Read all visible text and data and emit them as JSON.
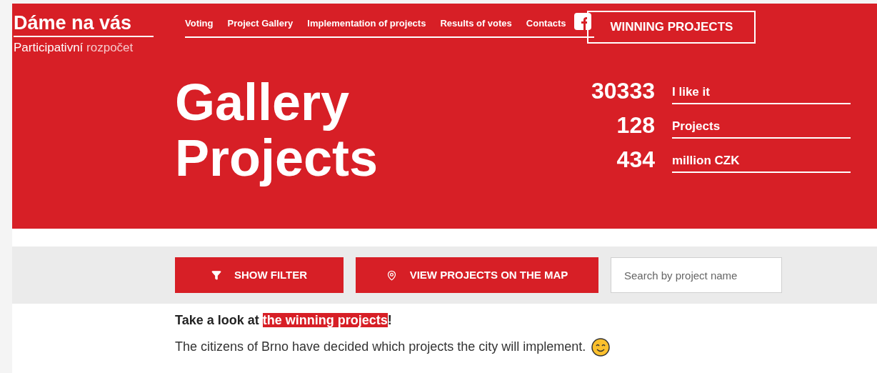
{
  "brand": {
    "name": "Dáme na vás",
    "tagline_strong": "Participativní",
    "tagline_light": "rozpočet"
  },
  "nav": {
    "items": [
      "Voting",
      "Project Gallery",
      "Implementation of projects",
      "Results of votes",
      "Contacts"
    ],
    "cta": "WINNING PROJECTS"
  },
  "hero": {
    "title_lines": [
      "Gallery",
      "Projects"
    ],
    "stats": [
      {
        "value": "30333",
        "label": "I like it"
      },
      {
        "value": "128",
        "label": "Projects"
      },
      {
        "value": "434",
        "label": "million CZK"
      }
    ]
  },
  "toolbar": {
    "filter_button": "SHOW FILTER",
    "map_button": "VIEW PROJECTS ON THE MAP",
    "search": {
      "placeholder": "Search by project name"
    }
  },
  "notice": {
    "prefix": "Take a look at ",
    "link": "the winning projects",
    "suffix": "!",
    "body": "The citizens of Brno have decided which projects the city will implement."
  }
}
